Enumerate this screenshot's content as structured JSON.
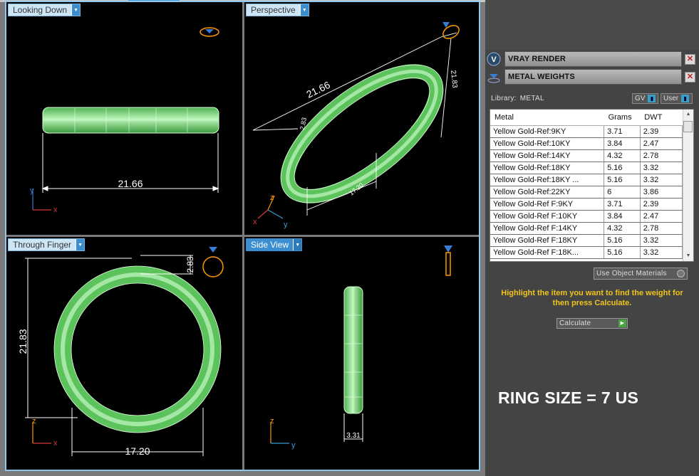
{
  "viewports": {
    "top_left": {
      "label": "Looking Down",
      "dimensions": [
        "21.66"
      ]
    },
    "top_right": {
      "label": "Perspective",
      "dimensions": [
        "21.66",
        "2.83",
        "21.83",
        "17.20"
      ]
    },
    "bottom_left": {
      "label": "Through Finger",
      "dimensions": [
        "21.83",
        "2.83",
        "17.20"
      ]
    },
    "bottom_right": {
      "label": "Side View",
      "dimensions": [
        "3.31"
      ]
    }
  },
  "axes": {
    "x": "x",
    "y": "y",
    "z": "z"
  },
  "panel": {
    "tools": [
      {
        "title": "VRAY RENDER",
        "icon": "vray-icon"
      },
      {
        "title": "METAL WEIGHTS",
        "icon": "metal-weights-icon"
      }
    ],
    "library_label": "Library:",
    "library_value": "METAL",
    "toggle_gv": "GV",
    "toggle_user": "User",
    "table": {
      "headers": [
        "Metal",
        "Grams",
        "DWT"
      ],
      "rows": [
        [
          "Yellow Gold-Ref:9KY",
          "3.71",
          "2.39"
        ],
        [
          "Yellow Gold-Ref:10KY",
          "3.84",
          "2.47"
        ],
        [
          "Yellow Gold-Ref:14KY",
          "4.32",
          "2.78"
        ],
        [
          "Yellow Gold-Ref:18KY",
          "5.16",
          "3.32"
        ],
        [
          "Yellow Gold-Ref:18KY ...",
          "5.16",
          "3.32"
        ],
        [
          "Yellow Gold-Ref:22KY",
          "6",
          "3.86"
        ],
        [
          "Yellow Gold-Ref F:9KY",
          "3.71",
          "2.39"
        ],
        [
          "Yellow Gold-Ref F:10KY",
          "3.84",
          "2.47"
        ],
        [
          "Yellow Gold-Ref F:14KY",
          "4.32",
          "2.78"
        ],
        [
          "Yellow Gold-Ref F:18KY",
          "5.16",
          "3.32"
        ],
        [
          "Yellow Gold-Ref F:18K...",
          "5.16",
          "3.32"
        ]
      ]
    },
    "use_object_materials": "Use Object Materials",
    "hint": "Highlight the item you want to find the weight for then press Calculate.",
    "calculate_label": "Calculate",
    "ring_size": "RING SIZE = 7 US"
  },
  "colors": {
    "ring_green": "#7ee07e",
    "viewport_border": "#8fc6ea",
    "hint_yellow": "#f0c41b",
    "icon_orange": "#ff9a00"
  }
}
